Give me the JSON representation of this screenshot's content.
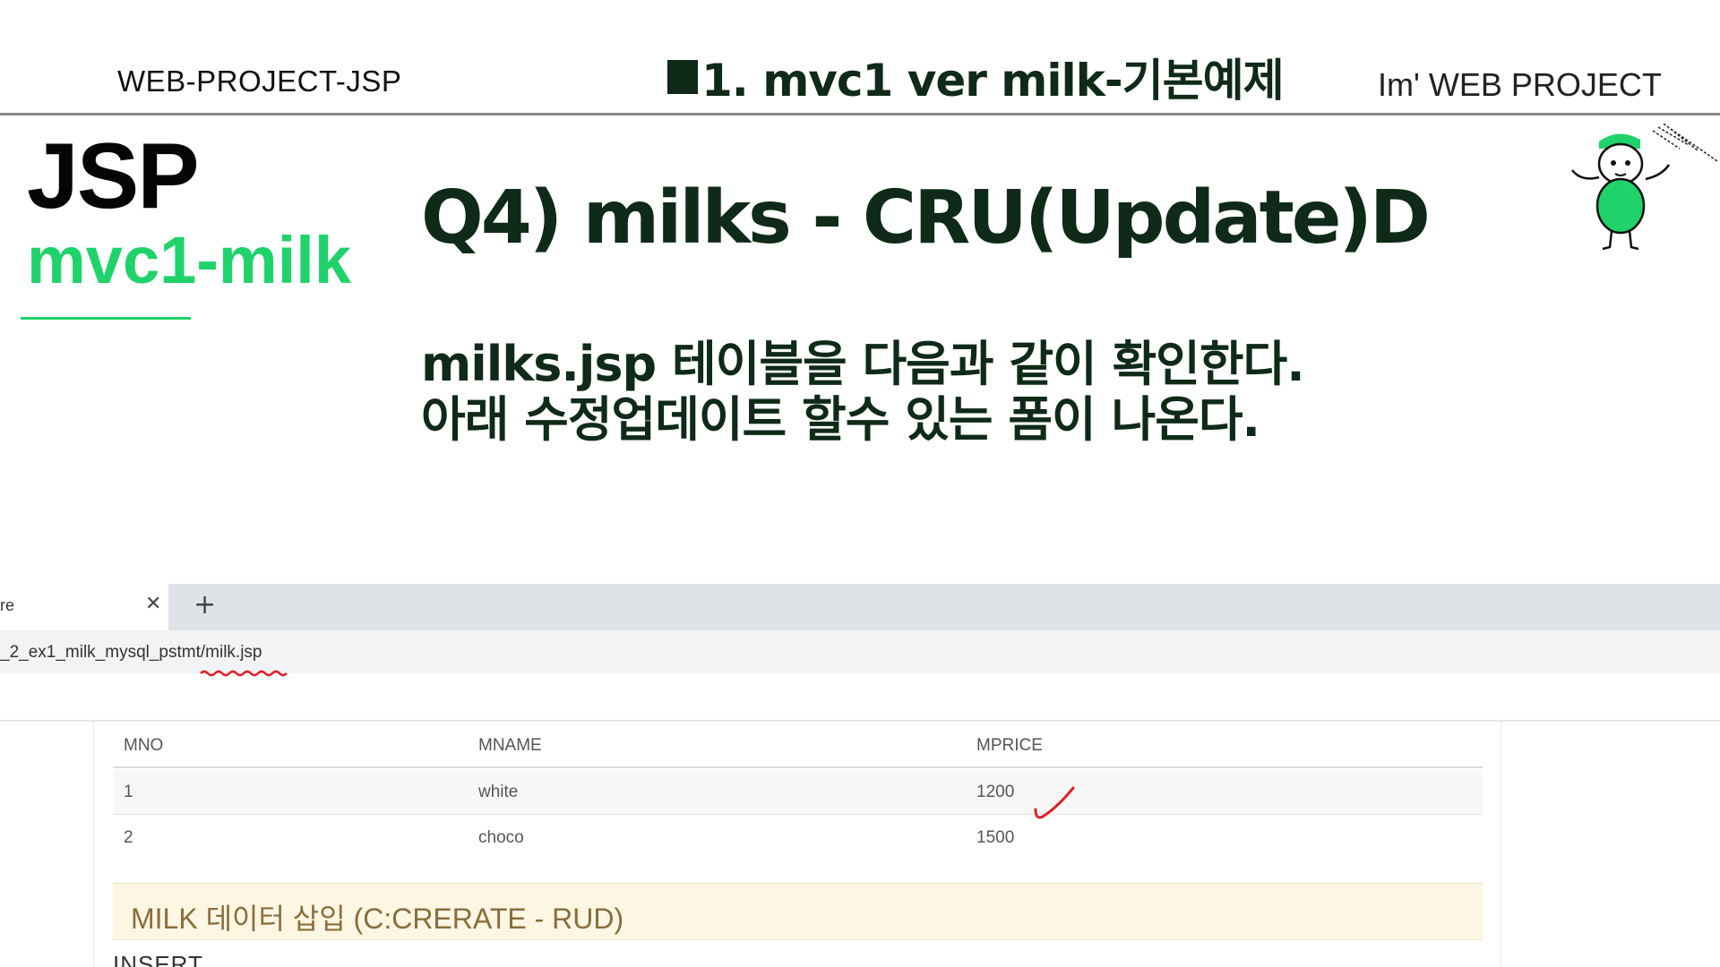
{
  "header": {
    "left": "WEB-PROJECT-JSP",
    "center": "1. mvc1 ver  milk-기본예제",
    "right": "Im'  WEB PROJECT"
  },
  "brand": {
    "title": "JSP",
    "subtitle": "mvc1-milk"
  },
  "question": "Q4) milks - CRU(Update)D",
  "description": [
    "milks.jsp 테이블을 다음과 같이 확인한다.",
    "아래 수정업데이트 할수 있는 폼이 나온다."
  ],
  "colors": {
    "accent_green": "#1fd36a",
    "dark_green_text": "#0f2a18",
    "insert_panel_bg": "#fcf6e3",
    "annotation_red": "#e0202a"
  },
  "browser": {
    "tab_title": "re",
    "close_icon": "close-icon",
    "new_tab_icon": "plus-icon",
    "url": "_2_ex1_milk_mysql_pstmt/milk.jsp"
  },
  "table": {
    "headers": [
      "MNO",
      "MNAME",
      "MPRICE"
    ],
    "rows": [
      [
        "1",
        "white",
        "1200"
      ],
      [
        "2",
        "choco",
        "1500"
      ]
    ]
  },
  "insert_panel": {
    "title": "MILK 데이터 삽입 (C:CRERATE - RUD)",
    "label": "INSERT"
  }
}
